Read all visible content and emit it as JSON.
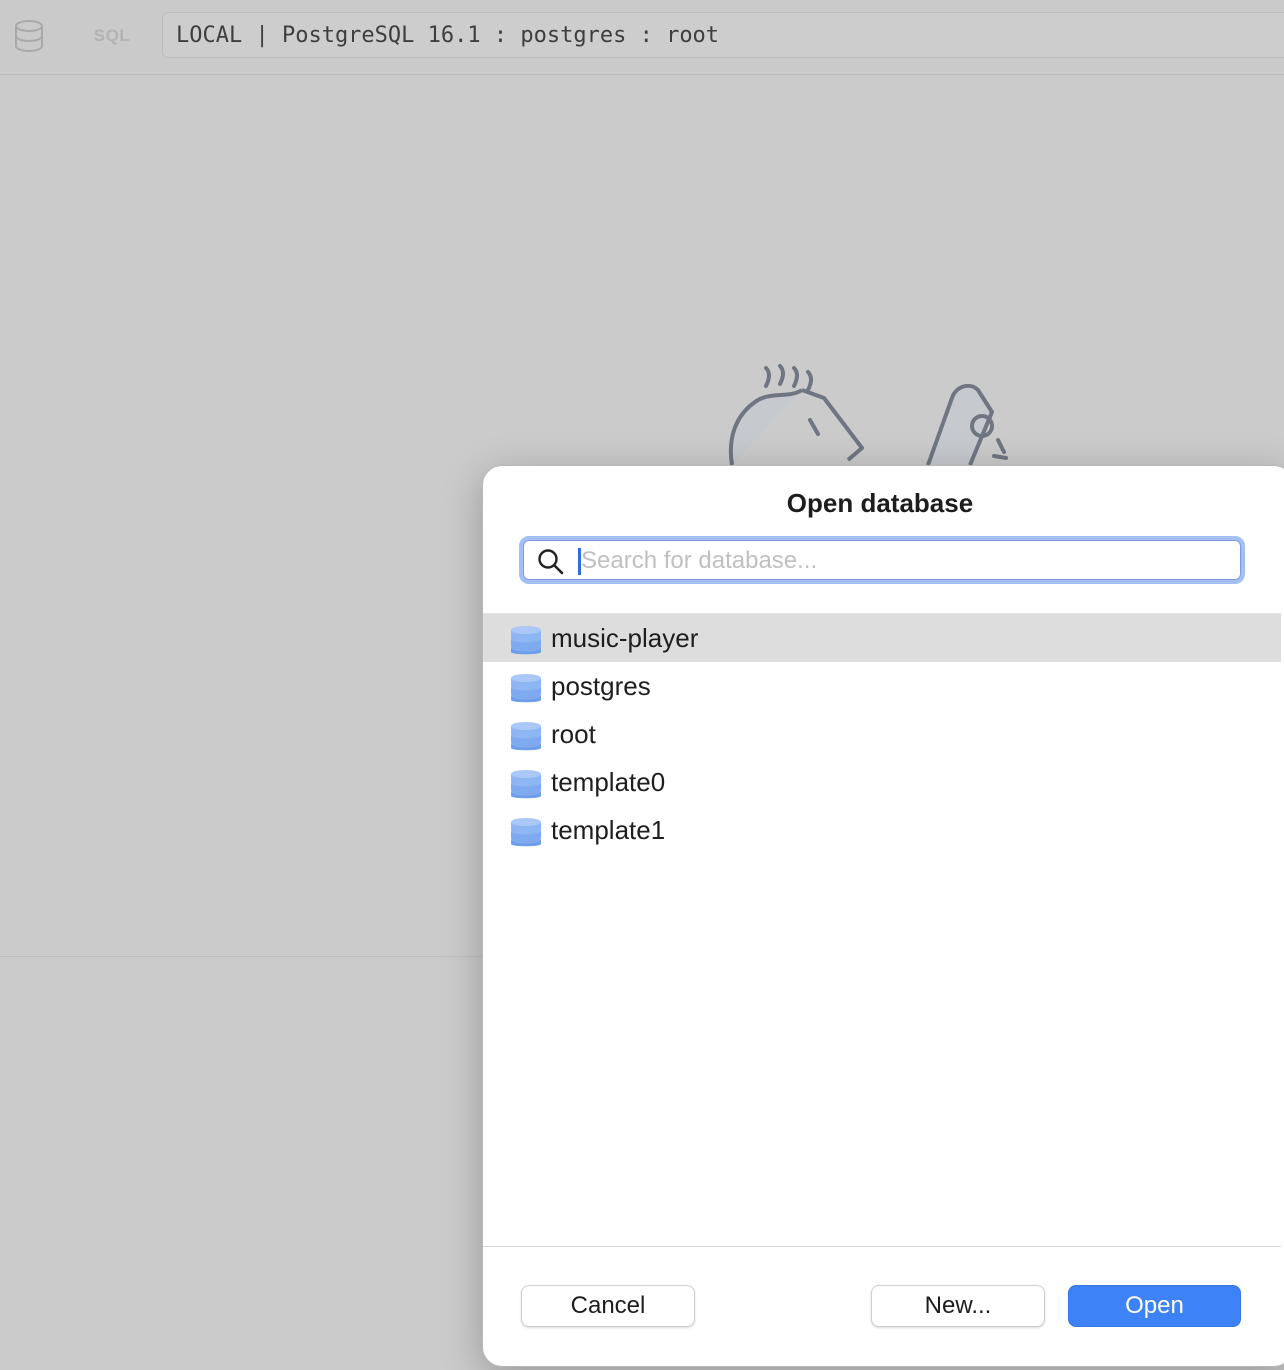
{
  "toolbar": {
    "database_icon": "database-icon",
    "sql_label": "SQL",
    "connection": "LOCAL | PostgreSQL 16.1 : postgres : root"
  },
  "dialog": {
    "title": "Open database",
    "search": {
      "icon": "search-icon",
      "placeholder": "Search for database...",
      "value": ""
    },
    "databases": [
      {
        "name": "music-player",
        "selected": true
      },
      {
        "name": "postgres",
        "selected": false
      },
      {
        "name": "root",
        "selected": false
      },
      {
        "name": "template0",
        "selected": false
      },
      {
        "name": "template1",
        "selected": false
      }
    ],
    "buttons": {
      "cancel": "Cancel",
      "new": "New...",
      "open": "Open"
    }
  },
  "colors": {
    "accent": "#3d82f6",
    "focus_ring": "#a5bff3",
    "selected_row": "#dddddd",
    "backdrop": "#cbcbcb"
  }
}
